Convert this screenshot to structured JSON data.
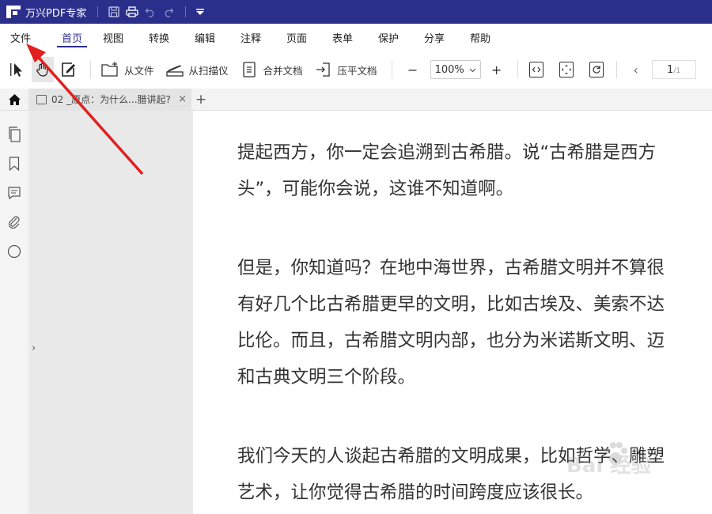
{
  "app": {
    "title": "万兴PDF专家"
  },
  "menu": {
    "items": [
      {
        "label": "文件",
        "active": false
      },
      {
        "label": "首页",
        "active": true
      },
      {
        "label": "视图",
        "active": false
      },
      {
        "label": "转换",
        "active": false
      },
      {
        "label": "编辑",
        "active": false
      },
      {
        "label": "注释",
        "active": false
      },
      {
        "label": "页面",
        "active": false
      },
      {
        "label": "表单",
        "active": false
      },
      {
        "label": "保护",
        "active": false
      },
      {
        "label": "分享",
        "active": false
      },
      {
        "label": "帮助",
        "active": false
      }
    ]
  },
  "toolbar": {
    "from_file": "从文件",
    "from_scanner": "从扫描仪",
    "merge_docs": "合并文档",
    "flatten_docs": "压平文档",
    "zoom_out": "−",
    "zoom_value": "100%",
    "zoom_in": "+",
    "prev_page": "‹",
    "current_page": "1",
    "total_pages": "/1"
  },
  "tabs": {
    "doc_tab_title": "02 _原点：为什么...腊讲起?",
    "close": "×",
    "new_tab": "+"
  },
  "sidebar": {
    "expander": "›"
  },
  "document": {
    "paragraphs": [
      [
        "提起西方，你一定会追溯到古希腊。说“古希腊是西方",
        "头”，可能你会说，这谁不知道啊。"
      ],
      [
        "但是，你知道吗？在地中海世界，古希腊文明并不算很",
        "有好几个比古希腊更早的文明，比如古埃及、美索不达",
        "比伦。而且，古希腊文明内部，也分为米诺斯文明、迈",
        "和古典文明三个阶段。"
      ],
      [
        "我们今天的人谈起古希腊的文明成果，比如哲学、雕塑",
        "艺术，让你觉得古希腊的时间跨度应该很长。"
      ]
    ]
  },
  "watermark": {
    "text": "Bai  经验"
  },
  "colors": {
    "brand": "#2b2f8c",
    "annotation_arrow": "#e02020"
  }
}
